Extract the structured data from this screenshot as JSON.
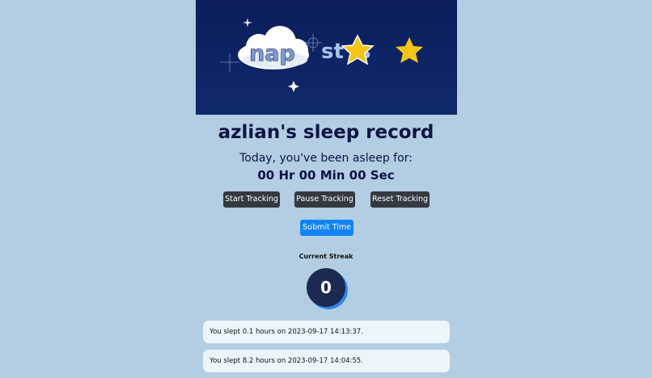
{
  "banner": {
    "logo_left": "nap",
    "logo_right": "st  s"
  },
  "page_title": "azlian's sleep record",
  "tracker": {
    "asleep_label": "Today, you've been asleep for:",
    "timer": "00 Hr 00 Min 00 Sec"
  },
  "buttons": {
    "start": "Start Tracking",
    "pause": "Pause Tracking",
    "reset": "Reset Tracking",
    "submit": "Submit Time"
  },
  "streak": {
    "label": "Current Streak",
    "value": "0"
  },
  "records": [
    "You slept 0.1 hours on 2023-09-17 14:13:37.",
    "You slept 8.2 hours on 2023-09-17 14:04:55."
  ],
  "colors": {
    "background": "#b3cde2",
    "banner": "#0c1d5a",
    "title": "#0c1445",
    "button_dark": "#343a40",
    "button_primary": "#1084f7",
    "streak_circle": "#1c2951",
    "star": "#f5c518"
  }
}
